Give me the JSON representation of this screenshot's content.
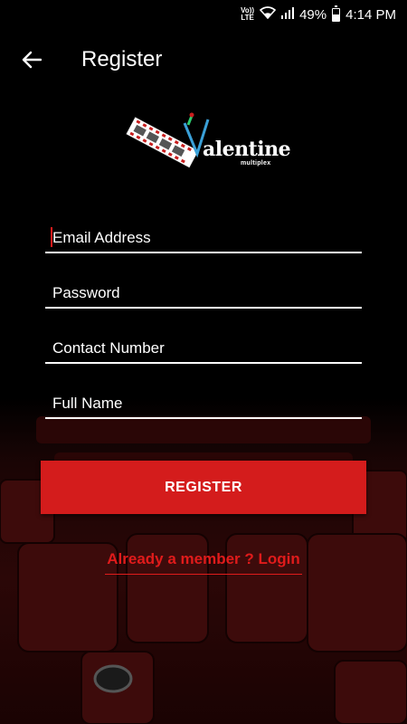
{
  "status_bar": {
    "carrier_top": "Vo))",
    "carrier_bottom": "LTE",
    "battery": "49%",
    "time": "4:14 PM"
  },
  "toolbar": {
    "title": "Register",
    "back_icon": "arrow-left-icon"
  },
  "logo": {
    "wordmark": "alentine",
    "tagline": "multiplex"
  },
  "form": {
    "email_placeholder": "Email Address",
    "password_placeholder": "Password",
    "contact_placeholder": "Contact Number",
    "name_placeholder": "Full Name"
  },
  "register_label": "REGISTER",
  "login_link": "Already a member ? Login",
  "colors": {
    "accent": "#d41c1c",
    "background": "#000000"
  }
}
